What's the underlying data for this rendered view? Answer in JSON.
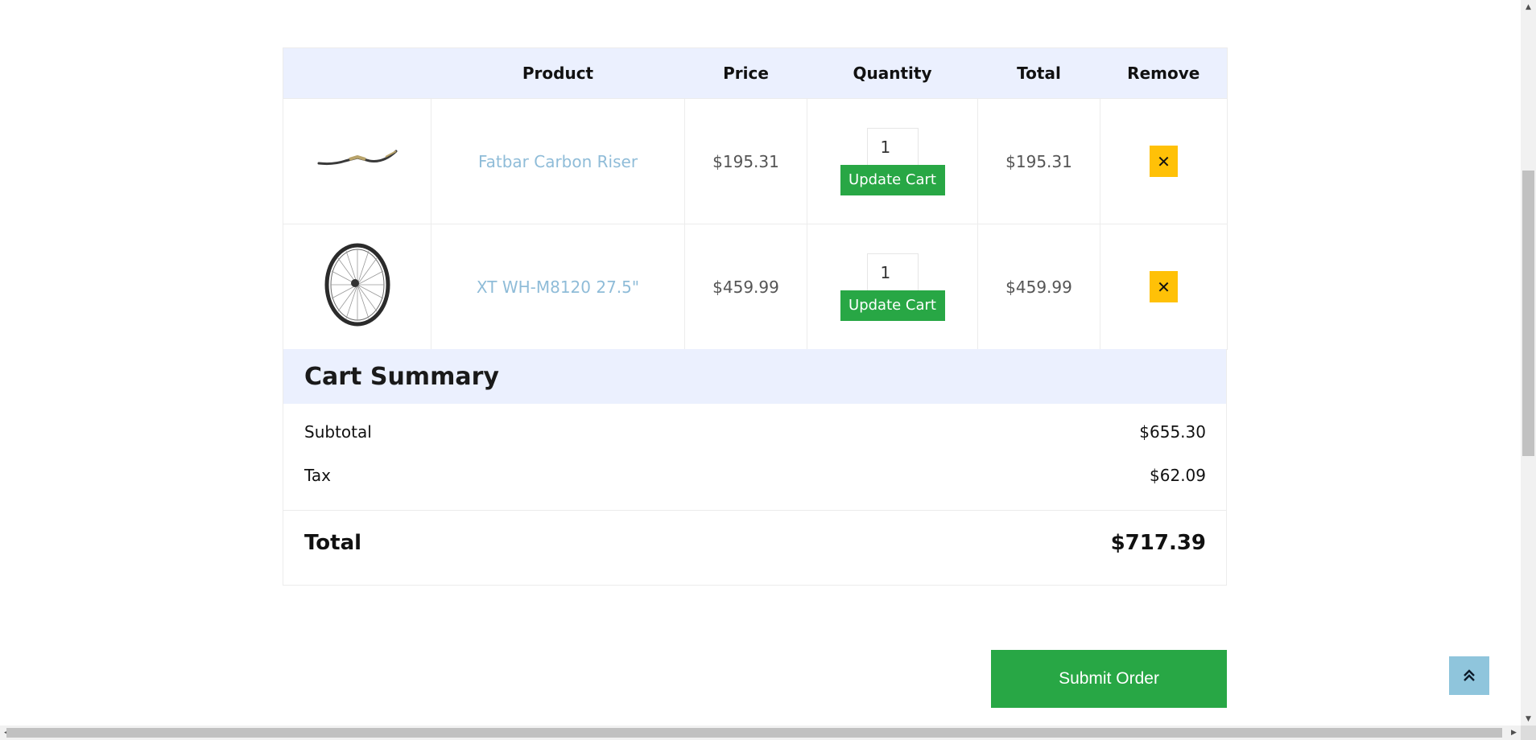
{
  "table": {
    "headers": [
      "",
      "Product",
      "Price",
      "Quantity",
      "Total",
      "Remove"
    ],
    "rows": [
      {
        "image_icon": "handlebar-image",
        "product": "Fatbar Carbon Riser",
        "price": "$195.31",
        "quantity": "1",
        "update_label": "Update Cart",
        "total": "$195.31",
        "remove_symbol": "✕"
      },
      {
        "image_icon": "wheel-image",
        "product": "XT WH-M8120 27.5\"",
        "price": "$459.99",
        "quantity": "1",
        "update_label": "Update Cart",
        "total": "$459.99",
        "remove_symbol": "✕"
      }
    ]
  },
  "summary": {
    "title": "Cart Summary",
    "subtotal_label": "Subtotal",
    "subtotal_value": "$655.30",
    "tax_label": "Tax",
    "tax_value": "$62.09",
    "total_label": "Total",
    "total_value": "$717.39"
  },
  "actions": {
    "submit_label": "Submit Order",
    "to_top_icon": "double-chevron-up-icon"
  },
  "colors": {
    "header_bg": "#ebf0fe",
    "accent_green": "#28a745",
    "remove_yellow": "#ffc107",
    "link_blue": "#8fbcd8",
    "to_top_bg": "#8fc5dc"
  }
}
